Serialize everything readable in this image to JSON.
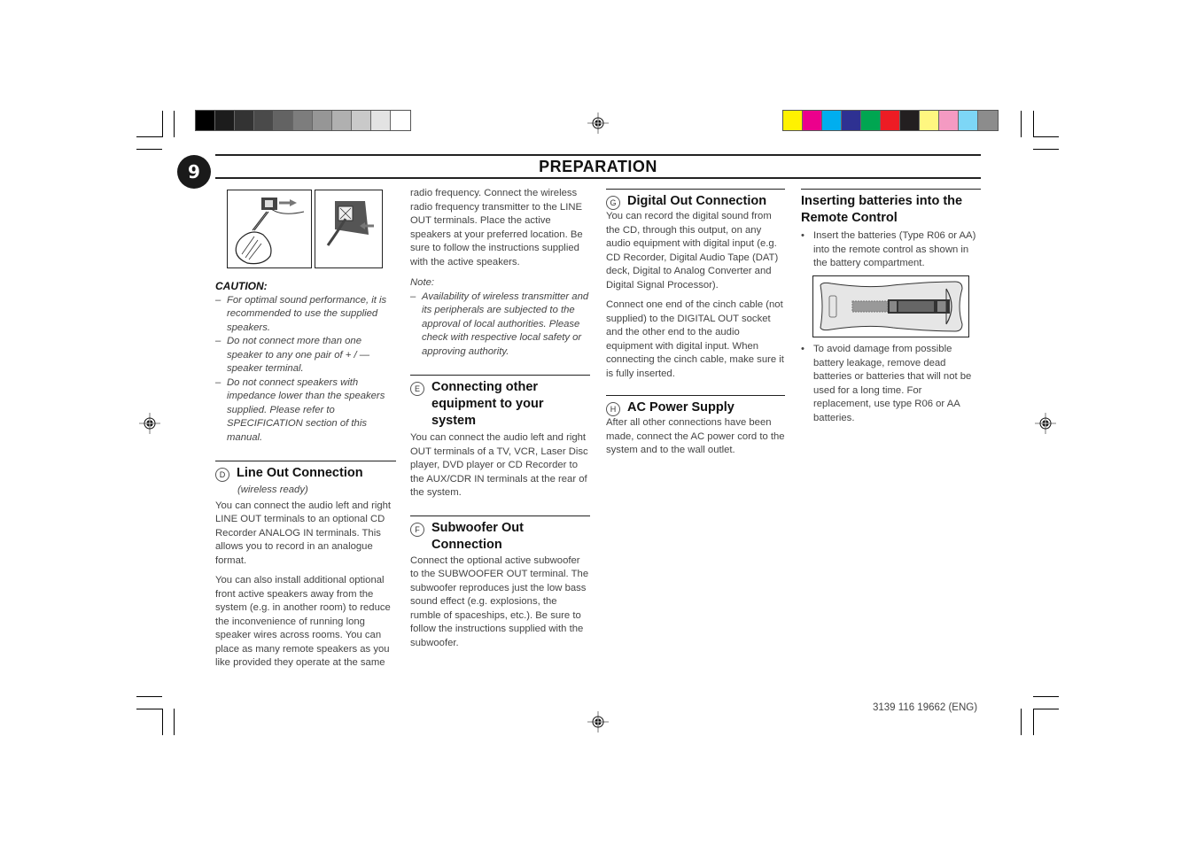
{
  "grayscale_bar": [
    "#000000",
    "#1c1c1c",
    "#333333",
    "#4a4a4a",
    "#636363",
    "#7d7d7d",
    "#969696",
    "#b0b0b0",
    "#c9c9c9",
    "#e3e3e3",
    "#ffffff"
  ],
  "color_bar": [
    "#fff200",
    "#ec008c",
    "#00aeef",
    "#2e3192",
    "#00a651",
    "#ed1c24",
    "#231f20",
    "#fff780",
    "#f49ac2",
    "#7dd6f6",
    "#8c8c8c"
  ],
  "header": {
    "page_number": "9",
    "title": "PREPARATION"
  },
  "caution": {
    "title": "CAUTION:",
    "items": [
      "For optimal sound performance, it is recommended to use the supplied speakers.",
      "Do not connect more than one speaker to any one pair of + / — speaker terminal.",
      "Do not connect speakers with impedance lower than the speakers supplied.  Please refer to SPECIFICATION section of this manual."
    ]
  },
  "sections": {
    "d": {
      "letter": "D",
      "title": "Line Out Connection",
      "subtitle": "(wireless ready)",
      "paragraphs": [
        "You can connect the audio left and right LINE OUT terminals to an optional CD Recorder ANALOG IN terminals. This allows you to record in an analogue format.",
        "You can also install additional optional front active speakers away from the system (e.g. in another room) to reduce the inconvenience of running long speaker wires across rooms. You can place as many remote speakers as you like provided they operate at the same"
      ],
      "continued": "radio frequency. Connect the wireless radio frequency transmitter to the LINE OUT terminals. Place the active speakers at your preferred location. Be sure to follow the instructions supplied with the active speakers.",
      "note_label": "Note:",
      "note": "Availability of wireless transmitter and its peripherals are subjected to the approval of local authorities. Please check with respective local safety or approving authority."
    },
    "e": {
      "letter": "E",
      "title": "Connecting other equipment to your system",
      "body": "You can connect the audio left and right OUT terminals of a  TV, VCR, Laser Disc player, DVD player or CD Recorder to the AUX/CDR IN terminals at the rear of the system."
    },
    "f": {
      "letter": "F",
      "title": "Subwoofer Out Connection",
      "body": "Connect the optional active subwoofer to the SUBWOOFER OUT terminal. The subwoofer reproduces just the low bass sound effect (e.g. explosions, the rumble of spaceships, etc.). Be sure to follow the instructions supplied with the subwoofer."
    },
    "g": {
      "letter": "G",
      "title": "Digital Out Connection",
      "paragraphs": [
        "You can record the digital sound from the CD, through this output, on any audio equipment with digital input (e.g. CD Recorder, Digital Audio Tape (DAT) deck, Digital to Analog Converter and Digital Signal Processor).",
        "Connect one end of the cinch cable (not supplied) to the DIGITAL OUT socket and the other end to the audio equipment with digital input. When connecting the cinch cable, make sure it is fully inserted."
      ]
    },
    "h": {
      "letter": "H",
      "title": "AC Power Supply",
      "body": "After all other connections have been made, connect the AC power cord to the system and to the wall outlet."
    },
    "batteries": {
      "title": "Inserting batteries into the Remote Control",
      "bullets": [
        "Insert the batteries  (Type R06 or AA)  into the remote control as shown in the battery compartment.",
        "To avoid damage from possible battery leakage, remove dead batteries or batteries that will not be used for a long time. For replacement, use type R06 or AA batteries."
      ]
    }
  },
  "footer": {
    "code": "3139 116 19662 (ENG)"
  }
}
